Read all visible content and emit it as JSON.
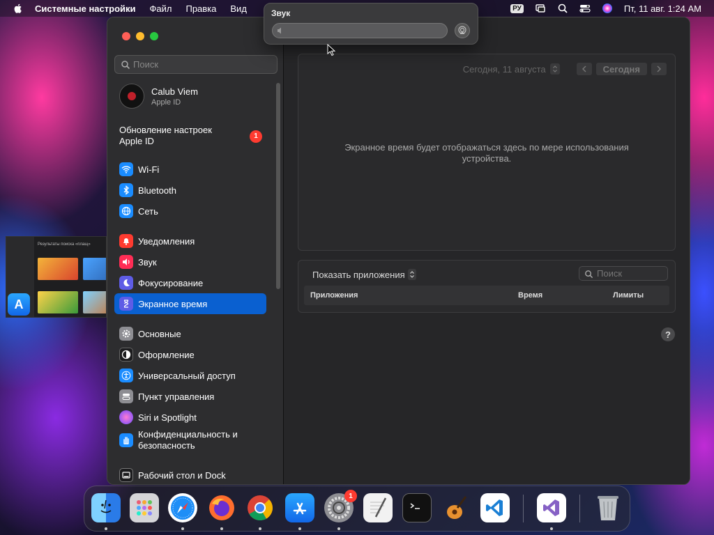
{
  "menubar": {
    "app_name": "Системные настройки",
    "items": [
      "Файл",
      "Правка",
      "Вид"
    ],
    "input_source": "РУ",
    "datetime": "Пт, 11 авг.  1:24 AM"
  },
  "sound_popover": {
    "title": "Звук",
    "volume_fraction": 0.0
  },
  "sidebar": {
    "search_placeholder": "Поиск",
    "user": {
      "name": "Calub Viem",
      "subtitle": "Apple ID"
    },
    "update": {
      "label": "Обновление настроек Apple ID",
      "badge": "1"
    },
    "items": [
      {
        "label": "Wi-Fi",
        "icon": "wifi-icon",
        "color": "#1a8cff"
      },
      {
        "label": "Bluetooth",
        "icon": "bluetooth-icon",
        "color": "#1a8cff"
      },
      {
        "label": "Сеть",
        "icon": "globe-icon",
        "color": "#1a8cff"
      },
      {
        "label": "Уведомления",
        "icon": "bell-icon",
        "color": "#ff3b30"
      },
      {
        "label": "Звук",
        "icon": "speaker-icon",
        "color": "#ff2d55"
      },
      {
        "label": "Фокусирование",
        "icon": "moon-icon",
        "color": "#5e5ce6"
      },
      {
        "label": "Экранное время",
        "icon": "hourglass-icon",
        "color": "#5e5ce6"
      },
      {
        "label": "Основные",
        "icon": "gear-icon",
        "color": "#8e8e93"
      },
      {
        "label": "Оформление",
        "icon": "appearance-icon",
        "color": "#1c1c1e"
      },
      {
        "label": "Универсальный доступ",
        "icon": "accessibility-icon",
        "color": "#1a8cff"
      },
      {
        "label": "Пункт управления",
        "icon": "control-center-icon",
        "color": "#8e8e93"
      },
      {
        "label": "Siri и Spotlight",
        "icon": "siri-icon",
        "color": "#b44dff"
      },
      {
        "label": "Конфиденциальность и безопасность",
        "icon": "hand-icon",
        "color": "#1a8cff"
      },
      {
        "label": "Рабочий стол и Dock",
        "icon": "dock-icon",
        "color": "#1c1c1e"
      }
    ],
    "selected": "Экранное время"
  },
  "content": {
    "date_label": "Сегодня, 11 августа",
    "today_button": "Сегодня",
    "empty_message": "Экранное время будет отображаться здесь по мере использования устройства.",
    "show_apps_label": "Показать приложения",
    "search_placeholder": "Поиск",
    "table_headers": [
      "Приложения",
      "Время",
      "Лимиты"
    ],
    "help": "?"
  },
  "thumbnail": {
    "title": "Результаты поиска «плащ»"
  },
  "dock": {
    "apps": [
      {
        "name": "Finder",
        "icon": "finder-icon"
      },
      {
        "name": "Launchpad",
        "icon": "launchpad-icon"
      },
      {
        "name": "Safari",
        "icon": "safari-icon"
      },
      {
        "name": "Firefox",
        "icon": "firefox-icon"
      },
      {
        "name": "Chrome",
        "icon": "chrome-icon"
      },
      {
        "name": "App Store",
        "icon": "app-store-icon"
      },
      {
        "name": "System Settings",
        "icon": "system-settings-icon",
        "badge": "1"
      },
      {
        "name": "TextEdit",
        "icon": "textedit-icon"
      },
      {
        "name": "Terminal",
        "icon": "terminal-icon"
      },
      {
        "name": "GarageBand",
        "icon": "garageband-icon"
      },
      {
        "name": "VS Code",
        "icon": "vscode-icon"
      },
      {
        "name": "Visual Studio",
        "icon": "visual-studio-icon"
      },
      {
        "name": "Trash",
        "icon": "trash-icon"
      }
    ]
  }
}
